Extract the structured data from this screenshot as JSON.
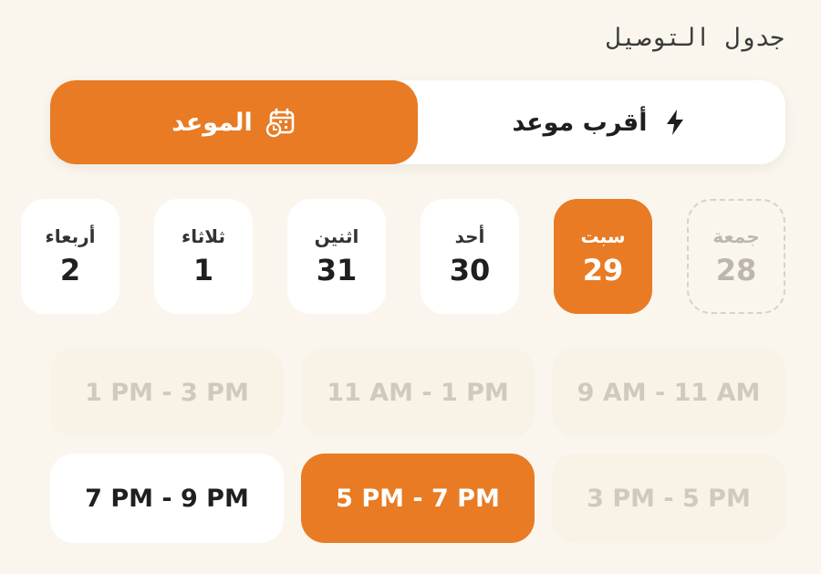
{
  "section_title": "جدول التوصيل",
  "mode_toggle": {
    "options": [
      {
        "label": "الموعد",
        "icon": "calendar-clock-icon",
        "active": true
      },
      {
        "label": "أقرب موعد",
        "icon": "lightning-bolt-icon",
        "active": false
      }
    ]
  },
  "days": [
    {
      "name": "أربعاء",
      "number": "2",
      "state": "available"
    },
    {
      "name": "ثلاثاء",
      "number": "1",
      "state": "available"
    },
    {
      "name": "اثنين",
      "number": "31",
      "state": "available"
    },
    {
      "name": "أحد",
      "number": "30",
      "state": "available"
    },
    {
      "name": "سبت",
      "number": "29",
      "state": "selected"
    },
    {
      "name": "جمعة",
      "number": "28",
      "state": "disabled"
    }
  ],
  "time_slots": [
    {
      "label": "1 PM - 3 PM",
      "state": "disabled"
    },
    {
      "label": "11 AM - 1 PM",
      "state": "disabled"
    },
    {
      "label": "9 AM - 11 AM",
      "state": "disabled"
    },
    {
      "label": "7 PM - 9 PM",
      "state": "available"
    },
    {
      "label": "5 PM - 7 PM",
      "state": "selected"
    },
    {
      "label": "3 PM - 5 PM",
      "state": "disabled"
    }
  ],
  "colors": {
    "accent": "#e87b23",
    "background": "#faf6ee",
    "card": "#ffffff",
    "disabled_text": "#cfc9c0"
  }
}
